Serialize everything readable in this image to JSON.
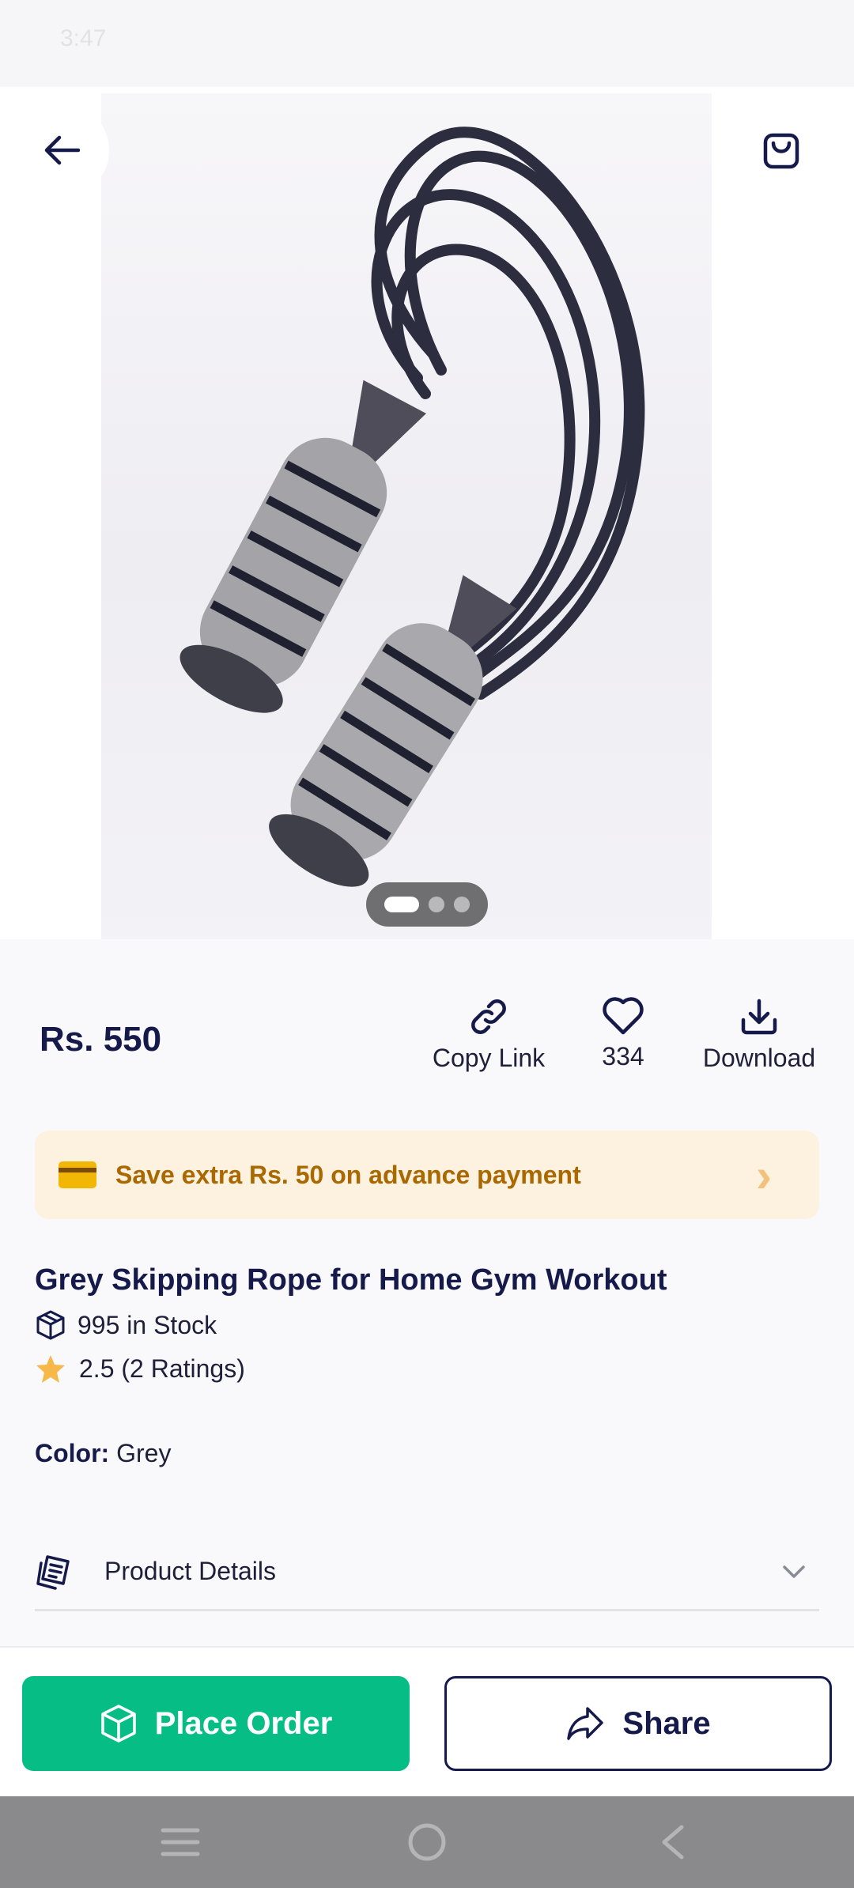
{
  "status_bar": {
    "time": "3:47"
  },
  "product": {
    "price": "Rs. 550",
    "title": "Grey Skipping Rope for Home Gym Workout",
    "stock": "995 in Stock",
    "rating": "2.5 (2 Ratings)",
    "color_label": "Color:",
    "color_value": "Grey",
    "gallery": {
      "image_count": 3,
      "active_index": 0
    }
  },
  "actions": {
    "copy_link": "Copy Link",
    "likes": "334",
    "download": "Download"
  },
  "promo": {
    "text": "Save extra Rs. 50 on advance payment"
  },
  "details": {
    "label": "Product Details"
  },
  "bottom": {
    "place_order": "Place Order",
    "share": "Share"
  },
  "colors": {
    "brand_navy": "#161a4a",
    "primary_green": "#05bd85",
    "promo_bg": "#fdf1e0",
    "promo_text": "#a96800",
    "star": "#f7b84a"
  },
  "icons": [
    "back-arrow-icon",
    "shopping-bag-icon",
    "link-icon",
    "heart-icon",
    "download-icon",
    "credit-card-icon",
    "chevron-right-icon",
    "box-icon",
    "star-icon",
    "document-icon",
    "chevron-down-icon",
    "cube-icon",
    "share-icon",
    "menu-icon",
    "home-icon",
    "back-icon"
  ]
}
